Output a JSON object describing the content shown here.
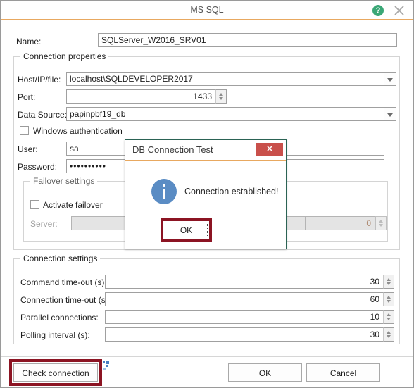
{
  "window": {
    "title": "MS SQL",
    "help_icon": "help-circle-icon",
    "close_icon": "close-icon",
    "accent_color": "#e8a860"
  },
  "form": {
    "name_label": "Name:",
    "name_value": "SQLServer_W2016_SRV01",
    "name_placeholder": ""
  },
  "connection_properties": {
    "title": "Connection properties",
    "host_label": "Host/IP/file:",
    "host_value": "localhost\\SQLDEVELOPER2017",
    "port_label": "Port:",
    "port_value": "1433",
    "datasource_label": "Data Source:",
    "datasource_value": "papinpbf19_db",
    "windows_auth_label": "Windows authentication",
    "windows_auth_checked": false,
    "user_label": "User:",
    "user_value": "sa",
    "password_label": "Password:",
    "password_value": "••••••••••"
  },
  "failover": {
    "title": "Failover settings",
    "activate_label": "Activate failover",
    "activate_checked": false,
    "server_label": "Server:",
    "server_value": "",
    "server_port_value": "0",
    "disabled": true
  },
  "connection_settings": {
    "title": "Connection settings",
    "rows": [
      {
        "label": "Command time-out (s):",
        "value": "30"
      },
      {
        "label": "Connection time-out (s):",
        "value": "60"
      },
      {
        "label": "Parallel connections:",
        "value": "10"
      },
      {
        "label": "Polling interval (s):",
        "value": "30"
      }
    ]
  },
  "footer": {
    "check_connection_label": "Check connection",
    "ok_label": "OK",
    "cancel_label": "Cancel",
    "highlight_color": "#8c1423"
  },
  "modal": {
    "title": "DB Connection Test",
    "close_label": "✕",
    "close_color": "#c9504b",
    "icon": "info-circle-icon",
    "icon_color": "#5a8cc4",
    "message": "Connection established!",
    "ok_label": "OK",
    "highlight_color": "#8c1423"
  }
}
